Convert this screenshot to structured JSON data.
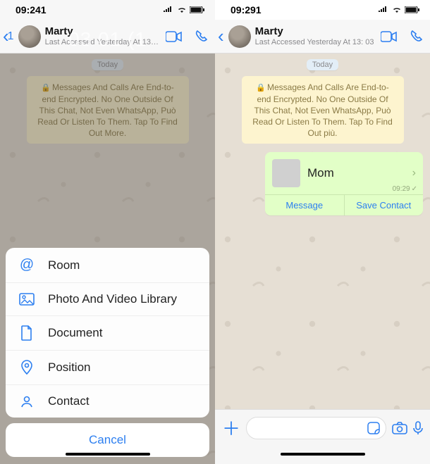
{
  "left": {
    "status_time": "09:241",
    "back_count": "1",
    "name": "Marty",
    "last_seen": "Last Accessed Yesterday At 13…",
    "today": "Today",
    "enc": "Messages And Calls Are End-to-end Encrypted. No One Outside Of This Chat, Not Even WhatsApp, Può Read Or Listen To Them. Tap To Find Out More.",
    "watermark": "03 01 (1",
    "sheet": {
      "items": [
        {
          "icon": "@",
          "label": "Room"
        },
        {
          "icon": "photo",
          "label": "Photo And Video Library"
        },
        {
          "icon": "doc",
          "label": "Document"
        },
        {
          "icon": "pin",
          "label": "Position"
        },
        {
          "icon": "contact",
          "label": "Contact"
        }
      ],
      "cancel": "Cancel"
    }
  },
  "right": {
    "status_time": "09:291",
    "name": "Marty",
    "last_seen": "Last Accessed Yesterday At 13: 03",
    "today": "Today",
    "enc": "Messages And Calls Are End-to-end Encrypted. No One Outside Of This Chat, Not Even WhatsApp, Può Read Or Listen To Them. Tap To Find Out più.",
    "contact_card": {
      "name": "Mom",
      "time": "09:29",
      "message_btn": "Message",
      "save_btn": "Save Contact"
    }
  }
}
